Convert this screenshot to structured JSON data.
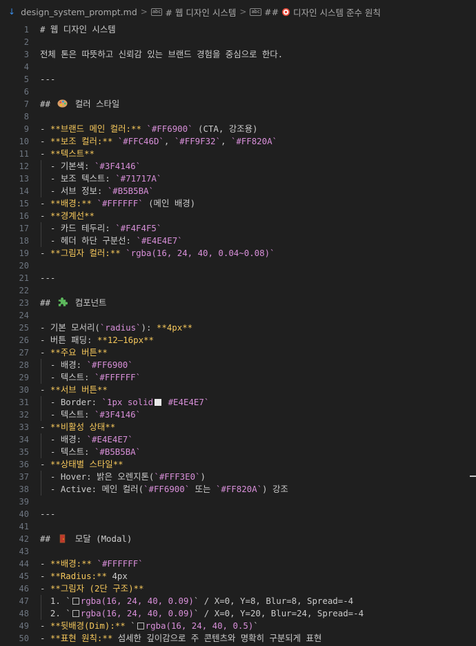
{
  "breadcrumb": {
    "file": "design_system_prompt.md",
    "crumb1": "# 웹 디자인 시스템",
    "crumb2_prefix": "## ",
    "crumb2_rest": " 디자인 시스템 준수 원칙",
    "symbol_label": "abc",
    "separator": ">"
  },
  "icons": {
    "file": "markdown-icon",
    "sep": "chevron-right-icon",
    "symbol": "symbol-string-icon",
    "palette": "palette-emoji-icon",
    "puzzle": "puzzle-emoji-icon",
    "door": "door-emoji-icon",
    "target": "target-emoji-icon"
  },
  "colors": {
    "background": "#1f1f1f",
    "line_number": "#6e7681",
    "heading_text": "#cccccc",
    "bold": "#f5c75b",
    "code": "#d88fd9"
  },
  "lines": [
    {
      "n": "1",
      "segs": [
        [
          "h",
          "# 웹 디자인 시스템"
        ]
      ]
    },
    {
      "n": "2",
      "segs": []
    },
    {
      "n": "3",
      "segs": [
        [
          "t",
          "전체 톤은 따뜻하고 신뢰감 있는 브랜드 경험을 중심으로 한다."
        ]
      ]
    },
    {
      "n": "4",
      "segs": []
    },
    {
      "n": "5",
      "segs": [
        [
          "t",
          "---"
        ]
      ]
    },
    {
      "n": "6",
      "segs": []
    },
    {
      "n": "7",
      "segs": [
        [
          "h",
          "## "
        ],
        [
          "emoji",
          "palette"
        ],
        [
          "h",
          " 컬러 스타일"
        ]
      ]
    },
    {
      "n": "8",
      "segs": []
    },
    {
      "n": "9",
      "segs": [
        [
          "t",
          "- "
        ],
        [
          "b",
          "**브랜드 메인 컬러:**"
        ],
        [
          "t",
          " "
        ],
        [
          "c",
          "`#FF6900`"
        ],
        [
          "t",
          " (CTA, 강조용)"
        ]
      ]
    },
    {
      "n": "10",
      "segs": [
        [
          "t",
          "- "
        ],
        [
          "b",
          "**보조 컬러:**"
        ],
        [
          "t",
          " "
        ],
        [
          "c",
          "`#FFC46D`"
        ],
        [
          "t",
          ", "
        ],
        [
          "c",
          "`#FF9F32`"
        ],
        [
          "t",
          ", "
        ],
        [
          "c",
          "`#FF820A`"
        ]
      ]
    },
    {
      "n": "11",
      "segs": [
        [
          "t",
          "- "
        ],
        [
          "b",
          "**텍스트**"
        ]
      ]
    },
    {
      "n": "12",
      "g": true,
      "segs": [
        [
          "t",
          "  - 기본색: "
        ],
        [
          "c",
          "`#3F4146`"
        ]
      ]
    },
    {
      "n": "13",
      "g": true,
      "segs": [
        [
          "t",
          "  - 보조 텍스트: "
        ],
        [
          "c",
          "`#71717A`"
        ]
      ]
    },
    {
      "n": "14",
      "g": true,
      "segs": [
        [
          "t",
          "  - 서브 정보: "
        ],
        [
          "c",
          "`#B5B5BA`"
        ]
      ]
    },
    {
      "n": "15",
      "segs": [
        [
          "t",
          "- "
        ],
        [
          "b",
          "**배경:**"
        ],
        [
          "t",
          " "
        ],
        [
          "c",
          "`#FFFFFF`"
        ],
        [
          "t",
          " (메인 배경)"
        ]
      ]
    },
    {
      "n": "16",
      "segs": [
        [
          "t",
          "- "
        ],
        [
          "b",
          "**경계선**"
        ]
      ]
    },
    {
      "n": "17",
      "g": true,
      "segs": [
        [
          "t",
          "  - 카드 테두리: "
        ],
        [
          "c",
          "`#F4F4F5`"
        ]
      ]
    },
    {
      "n": "18",
      "g": true,
      "segs": [
        [
          "t",
          "  - 헤더 하단 구분선: "
        ],
        [
          "c",
          "`#E4E4E7`"
        ]
      ]
    },
    {
      "n": "19",
      "segs": [
        [
          "t",
          "- "
        ],
        [
          "b",
          "**그림자 컬러:**"
        ],
        [
          "t",
          " "
        ],
        [
          "c",
          "`rgba(16, 24, 40, 0.04~0.08)`"
        ]
      ]
    },
    {
      "n": "20",
      "segs": []
    },
    {
      "n": "21",
      "segs": [
        [
          "t",
          "---"
        ]
      ]
    },
    {
      "n": "22",
      "segs": []
    },
    {
      "n": "23",
      "segs": [
        [
          "h",
          "## "
        ],
        [
          "emoji",
          "puzzle"
        ],
        [
          "h",
          " 컴포넌트"
        ]
      ]
    },
    {
      "n": "24",
      "segs": []
    },
    {
      "n": "25",
      "segs": [
        [
          "t",
          "- 기본 모서리("
        ],
        [
          "c",
          "`radius`"
        ],
        [
          "t",
          "): "
        ],
        [
          "b",
          "**4px**"
        ]
      ]
    },
    {
      "n": "26",
      "segs": [
        [
          "t",
          "- 버튼 패딩: "
        ],
        [
          "b",
          "**12–16px**"
        ]
      ]
    },
    {
      "n": "27",
      "segs": [
        [
          "t",
          "- "
        ],
        [
          "b",
          "**주요 버튼**"
        ]
      ]
    },
    {
      "n": "28",
      "g": true,
      "segs": [
        [
          "t",
          "  - 배경: "
        ],
        [
          "c",
          "`#FF6900`"
        ]
      ]
    },
    {
      "n": "29",
      "g": true,
      "segs": [
        [
          "t",
          "  - 텍스트: "
        ],
        [
          "c",
          "`#FFFFFF`"
        ]
      ]
    },
    {
      "n": "30",
      "segs": [
        [
          "t",
          "- "
        ],
        [
          "b",
          "**서브 버튼**"
        ]
      ]
    },
    {
      "n": "31",
      "g": true,
      "segs": [
        [
          "t",
          "  - Border: "
        ],
        [
          "c",
          "`1px solid"
        ],
        [
          "sw",
          "solid"
        ],
        [
          "c",
          " #E4E4E7`"
        ]
      ]
    },
    {
      "n": "32",
      "g": true,
      "segs": [
        [
          "t",
          "  - 텍스트: "
        ],
        [
          "c",
          "`#3F4146`"
        ]
      ]
    },
    {
      "n": "33",
      "segs": [
        [
          "t",
          "- "
        ],
        [
          "b",
          "**비활성 상태**"
        ]
      ]
    },
    {
      "n": "34",
      "g": true,
      "segs": [
        [
          "t",
          "  - 배경: "
        ],
        [
          "c",
          "`#E4E4E7`"
        ]
      ]
    },
    {
      "n": "35",
      "g": true,
      "segs": [
        [
          "t",
          "  - 텍스트: "
        ],
        [
          "c",
          "`#B5B5BA`"
        ]
      ]
    },
    {
      "n": "36",
      "segs": [
        [
          "t",
          "- "
        ],
        [
          "b",
          "**상태별 스타일**"
        ]
      ]
    },
    {
      "n": "37",
      "g": true,
      "segs": [
        [
          "t",
          "  - Hover: 밝은 오렌지톤("
        ],
        [
          "c",
          "`#FFF3E0`"
        ],
        [
          "t",
          ")"
        ]
      ]
    },
    {
      "n": "38",
      "g": true,
      "segs": [
        [
          "t",
          "  - Active: 메인 컬러("
        ],
        [
          "c",
          "`#FF6900`"
        ],
        [
          "t",
          " 또는 "
        ],
        [
          "c",
          "`#FF820A`"
        ],
        [
          "t",
          ") 강조"
        ]
      ]
    },
    {
      "n": "39",
      "segs": []
    },
    {
      "n": "40",
      "segs": [
        [
          "t",
          "---"
        ]
      ]
    },
    {
      "n": "41",
      "segs": []
    },
    {
      "n": "42",
      "segs": [
        [
          "h",
          "## "
        ],
        [
          "emoji",
          "door"
        ],
        [
          "h",
          " 모달 (Modal)"
        ]
      ]
    },
    {
      "n": "43",
      "segs": []
    },
    {
      "n": "44",
      "segs": [
        [
          "t",
          "- "
        ],
        [
          "b",
          "**배경:**"
        ],
        [
          "t",
          " "
        ],
        [
          "c",
          "`#FFFFFF`"
        ]
      ]
    },
    {
      "n": "45",
      "segs": [
        [
          "t",
          "- "
        ],
        [
          "b",
          "**Radius:**"
        ],
        [
          "t",
          " 4px"
        ]
      ]
    },
    {
      "n": "46",
      "segs": [
        [
          "t",
          "- "
        ],
        [
          "b",
          "**그림자 (2단 구조)**"
        ]
      ]
    },
    {
      "n": "47",
      "g": true,
      "segs": [
        [
          "t",
          "  1. `"
        ],
        [
          "sw",
          "hollow"
        ],
        [
          "c",
          "rgba(16, 24, 40, 0.09)"
        ],
        [
          "t",
          "` / X=0, Y=8, Blur=8, Spread=-4"
        ]
      ]
    },
    {
      "n": "48",
      "g": true,
      "segs": [
        [
          "t",
          "  2. `"
        ],
        [
          "sw",
          "hollow"
        ],
        [
          "c",
          "rgba(16, 24, 40, 0.09)"
        ],
        [
          "t",
          "` / X=0, Y=20, Blur=24, Spread=-4"
        ]
      ]
    },
    {
      "n": "49",
      "segs": [
        [
          "t",
          "- "
        ],
        [
          "b",
          "**뒷배경(Dim):**"
        ],
        [
          "t",
          " `"
        ],
        [
          "sw",
          "hollow"
        ],
        [
          "c",
          "rgba(16, 24, 40, 0.5)"
        ],
        [
          "t",
          "`"
        ]
      ]
    },
    {
      "n": "50",
      "segs": [
        [
          "t",
          "- "
        ],
        [
          "b",
          "**표현 원칙:**"
        ],
        [
          "t",
          " 섬세한 깊이감으로 주 콘텐츠와 명확히 구분되게 표현"
        ]
      ]
    }
  ]
}
